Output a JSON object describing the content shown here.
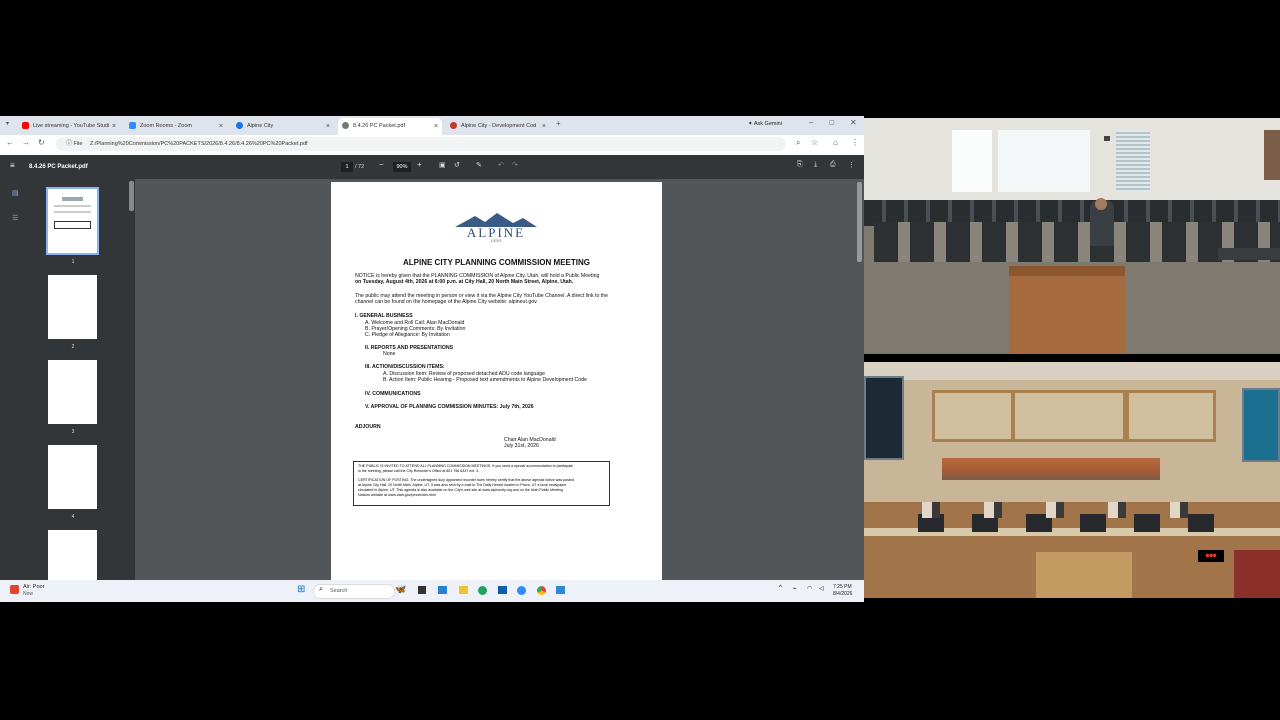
{
  "browser": {
    "tabs": [
      {
        "label": "Live streaming - YouTube Studi",
        "icon": "youtube-icon",
        "color": "#ff0000"
      },
      {
        "label": "Zoom Rooms - Zoom",
        "icon": "zoom-icon",
        "color": "#2d8cff"
      },
      {
        "label": "Alpine City",
        "icon": "globe-icon",
        "color": "#1a73e8"
      },
      {
        "label": "8.4.26 PC Packet.pdf",
        "icon": "pdf-icon",
        "color": "#555555"
      },
      {
        "label": "Alpine City - Development Cod",
        "icon": "city-icon",
        "color": "#c0392b"
      }
    ],
    "ask_gemini": "Ask Gemini",
    "file_label": "File",
    "url": "Z:/Planning%20Commission/PC%20PACKETS/2026/8.4.26/8.4.26%20PC%20Packet.pdf"
  },
  "pdf": {
    "title": "8.4.26 PC Packet.pdf",
    "page_current": "1",
    "page_total": "/ 72",
    "zoom": "90%",
    "thumbnails": [
      "1",
      "2",
      "3",
      "4"
    ]
  },
  "doc": {
    "logo": "ALPINE",
    "logo_year": "1 8 5 0",
    "heading": "ALPINE CITY PLANNING COMMISSION MEETING",
    "notice_line1": "NOTICE is hereby given that the PLANNING COMMISSION of Alpine City, Utah, will hold a Public Meeting",
    "notice_line2": "on Tuesday, August 4th, 2026 at 6:00 p.m. at City Hall, 20 North Main Street, Alpine, Utah.",
    "public_line1": "The public may attend the meeting in person or view it via the Alpine City YouTube Channel. A direct link to the",
    "public_line2": "channel can be found on the homepage of the Alpine City website: alpineut.gov.",
    "sec1": "I.   GENERAL BUSINESS",
    "sec1a": "A.          Welcome and Roll Call: Alan MacDonald",
    "sec1b": "B.          Prayer/Opening Comments: By Invitation",
    "sec1c": "C.          Pledge of Allegiance: By Invitation",
    "sec2": "II.        REPORTS AND PRESENTATIONS",
    "sec2body": "None",
    "sec3": "III.       ACTION/DISCUSSION ITEMS:",
    "sec3a": "A.   Discussion Item: Review of proposed detached ADU code language",
    "sec3b": "B.   Action Item: Public Hearing - Proposed text amendments to Alpine Development Code",
    "sec4": "IV.       COMMUNICATIONS",
    "sec5": "V.        APPROVAL OF PLANNING COMMISSION MINUTES: July 7th, 2026",
    "adjourn": "ADJOURN",
    "chair": "Chair Alan MacDonald",
    "chair_date": "July 31st, 2026",
    "box1": "THE PUBLIC IS INVITED TO ATTEND ALL PLANNING COMMISSION MEETINGS. If you need a special accommodation to participate",
    "box2": "in the meeting, please call the City Recorder's Office at 801 756 6347 ext. 3.",
    "box3": "CERTIFICATION OF POSTING. The undersigned duly appointed recorder does hereby certify that the above agenda notice was posted",
    "box4": "at Alpine City Hall, 20 North Main, Alpine, UT. It was also sent by e-mail to The Daily Herald located in Provo, UT a local newspaper",
    "box5": "circulated in Alpine, UT. This agenda is also available on the City's web site at www.alpinecity.org and on the Utah Public Meeting",
    "box6": "Notices website at www.utah.gov/pmn/index.html"
  },
  "taskbar": {
    "weather_title": "Air: Poor",
    "weather_sub": "Now",
    "search": "Search",
    "time": "7:25 PM",
    "date": "8/4/2026"
  },
  "colors": {
    "accent": "#1a73e8",
    "pdf_toolbar": "#323639",
    "pdf_bg": "#525659"
  }
}
